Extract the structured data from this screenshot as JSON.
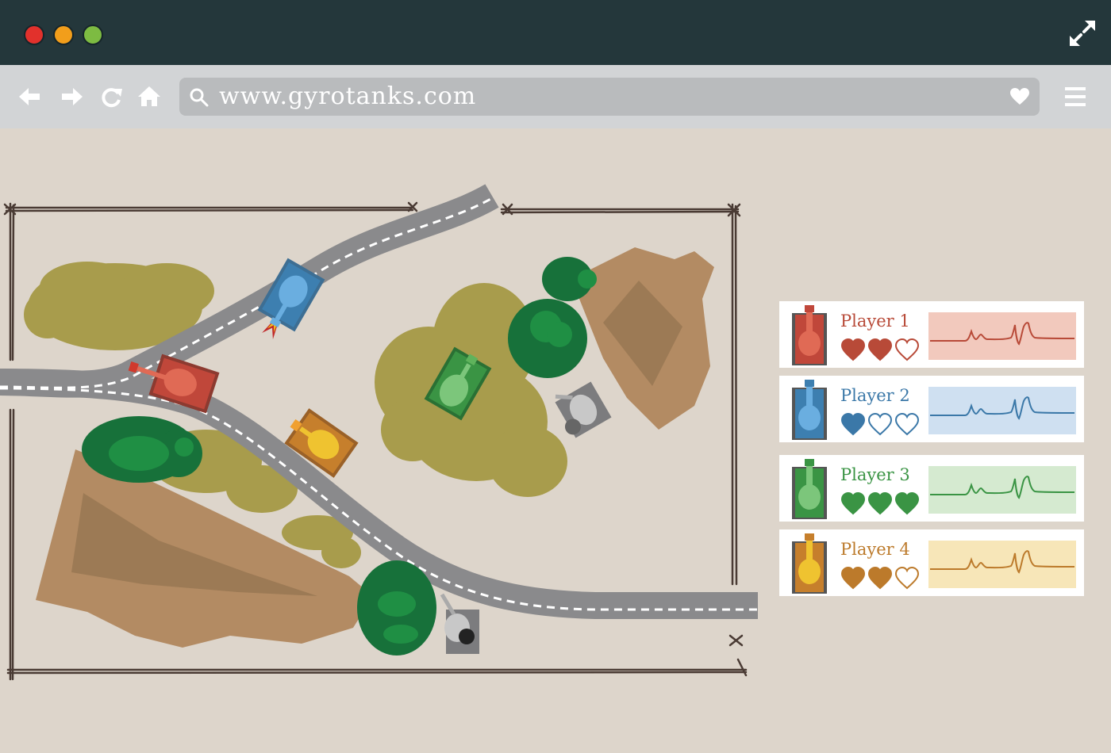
{
  "window": {
    "controls": [
      "close",
      "minimize",
      "zoom"
    ],
    "fullscreen_icon": "expand-icon"
  },
  "toolbar": {
    "url": "www.gyrotanks.com",
    "icons": [
      "back-arrow-icon",
      "forward-arrow-icon",
      "reload-icon",
      "home-icon",
      "search-icon",
      "heart-icon",
      "hamburger-menu-icon"
    ]
  },
  "players": [
    {
      "name": "Player 1",
      "color": "#b84a38",
      "fill": "#f2c9bd",
      "tank_body": "#c0473a",
      "tank_turret": "#e06a55",
      "lives": 2,
      "max_lives": 3
    },
    {
      "name": "Player 2",
      "color": "#3b78a8",
      "fill": "#cfe0f1",
      "tank_body": "#3d7fb0",
      "tank_turret": "#6aaee0",
      "lives": 1,
      "max_lives": 3
    },
    {
      "name": "Player 3",
      "color": "#3a9444",
      "fill": "#d5ead0",
      "tank_body": "#3a9444",
      "tank_turret": "#7cc67b",
      "lives": 3,
      "max_lives": 3
    },
    {
      "name": "Player 4",
      "color": "#bc7a2b",
      "fill": "#f7e6b8",
      "tank_body": "#c67f2c",
      "tank_turret": "#efc330",
      "lives": 2,
      "max_lives": 3
    }
  ],
  "colors": {
    "background": "#ddd5cb",
    "titlebar": "#24373b",
    "toolbar": "#d2d4d6",
    "road": "#8a8a8c",
    "bush": "#a89c4c",
    "tree": "#17713a",
    "dirt": "#b38b63"
  }
}
